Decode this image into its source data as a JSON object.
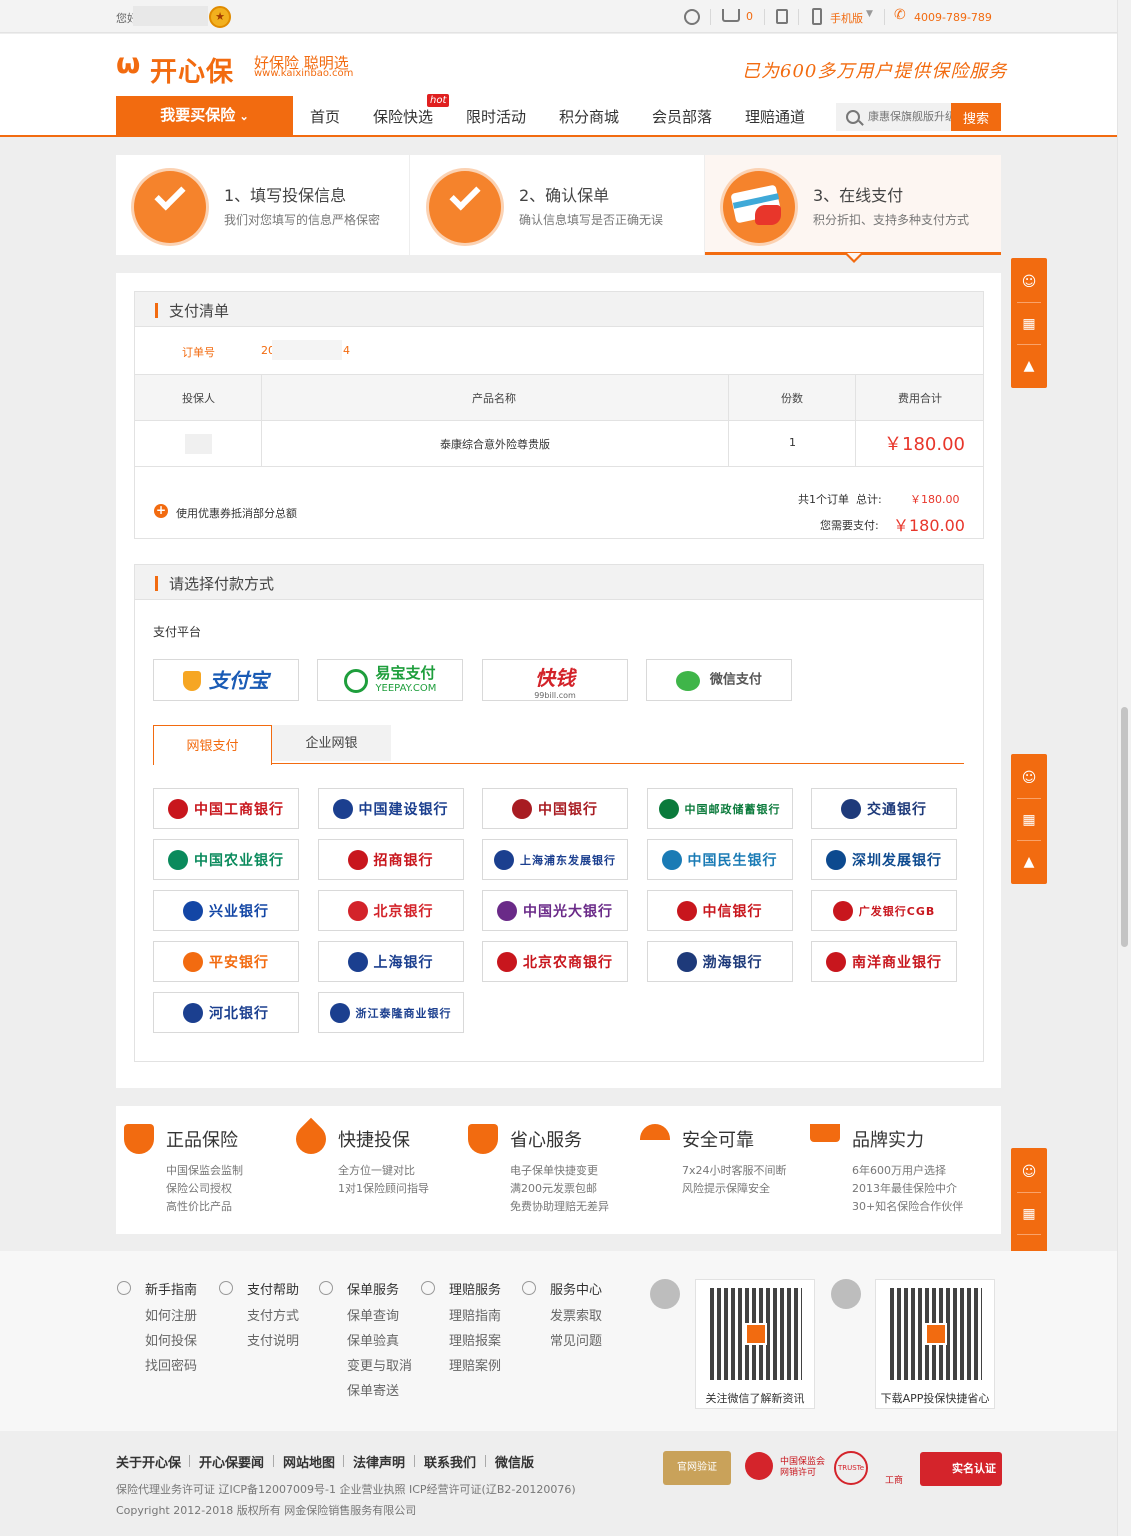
{
  "topbar": {
    "greeting": "您好",
    "cart_count": "0",
    "mobile_label": "手机版",
    "phone": "4009-789-789"
  },
  "header": {
    "logo_name": "开心保",
    "logo_slogan": "好保险 聪明选",
    "logo_url": "www.kaixinbao.com",
    "claim": "已为600多万用户提供保险服务",
    "buy_button": "我要买保险",
    "nav": [
      "首页",
      "保险快选",
      "限时活动",
      "积分商城",
      "会员部落",
      "理赔通道"
    ],
    "hot_badge": "hot",
    "search_placeholder": "康惠保旗舰版升级",
    "search_button": "搜索"
  },
  "steps": [
    {
      "title": "1、填写投保信息",
      "sub": "我们对您填写的信息严格保密"
    },
    {
      "title": "2、确认保单",
      "sub": "确认信息填写是否正确无误"
    },
    {
      "title": "3、在线支付",
      "sub": "积分折扣、支持多种支付方式"
    }
  ],
  "payment_list": {
    "title": "支付清单",
    "order_label": "订单号",
    "order_no_start": "20",
    "order_no_end": "4",
    "columns": [
      "投保人",
      "产品名称",
      "份数",
      "费用合计"
    ],
    "rows": [
      {
        "insured": "",
        "product": "泰康综合意外险尊贵版",
        "qty": "1",
        "total": "￥180.00"
      }
    ],
    "coupon_label": "使用优惠券抵消部分总额",
    "summary_label": "共1个订单  总计:",
    "summary_value": "￥180.00",
    "pay_label": "您需要支付:",
    "pay_value": "￥180.00"
  },
  "payment_method": {
    "title": "请选择付款方式",
    "platform_label": "支付平台",
    "platforms": [
      {
        "name": "支付宝",
        "color": "#1a5bb5"
      },
      {
        "name": "易宝支付",
        "sub": "YEEPAY.COM",
        "color": "#1e9e3c"
      },
      {
        "name": "快钱",
        "sub": "99bill.com",
        "color": "#d3232a"
      },
      {
        "name": "微信支付",
        "color": "#555555"
      }
    ],
    "tabs": [
      "网银支付",
      "企业网银"
    ],
    "banks": [
      {
        "name": "中国工商银行",
        "color": "#c8161d"
      },
      {
        "name": "中国建设银行",
        "color": "#1b3f8f"
      },
      {
        "name": "中国银行",
        "color": "#a81c22"
      },
      {
        "name": "中国邮政储蓄银行",
        "color": "#0a7a3b"
      },
      {
        "name": "交通银行",
        "color": "#1e3a7a"
      },
      {
        "name": "中国农业银行",
        "color": "#0a8a5c"
      },
      {
        "name": "招商银行",
        "color": "#c8161d"
      },
      {
        "name": "上海浦东发展银行",
        "color": "#1b3f8f"
      },
      {
        "name": "中国民生银行",
        "color": "#1a7bb5"
      },
      {
        "name": "深圳发展银行",
        "color": "#0d4a8f"
      },
      {
        "name": "兴业银行",
        "color": "#1346a5"
      },
      {
        "name": "北京银行",
        "color": "#d3232a"
      },
      {
        "name": "中国光大银行",
        "color": "#6a2a88"
      },
      {
        "name": "中信银行",
        "color": "#c8161d"
      },
      {
        "name": "广发银行CGB",
        "color": "#c8161d"
      },
      {
        "name": "平安银行",
        "color": "#f26b10"
      },
      {
        "name": "上海银行",
        "color": "#1b3f8f"
      },
      {
        "name": "北京农商银行",
        "color": "#c8161d"
      },
      {
        "name": "渤海银行",
        "color": "#1e3a7a"
      },
      {
        "name": "南洋商业银行",
        "color": "#c8161d"
      },
      {
        "name": "河北银行",
        "color": "#1b3f8f"
      },
      {
        "name": "浙江泰隆商业银行",
        "color": "#1b3f8f"
      }
    ]
  },
  "features": [
    {
      "title": "正品保险",
      "lines": [
        "中国保监会监制",
        "保险公司授权",
        "高性价比产品"
      ],
      "icon": "shield-icon"
    },
    {
      "title": "快捷投保",
      "lines": [
        "全方位一键对比",
        "1对1保险顾问指导"
      ],
      "icon": "rocket-icon"
    },
    {
      "title": "省心服务",
      "lines": [
        "电子保单快捷变更",
        "满200元发票包邮",
        "免费协助理赔无差异"
      ],
      "icon": "badge-icon"
    },
    {
      "title": "安全可靠",
      "lines": [
        "7x24小时客服不间断",
        "风险提示保障安全"
      ],
      "icon": "umbrella-icon"
    },
    {
      "title": "品牌实力",
      "lines": [
        "6年600万用户选择",
        "2013年最佳保险中介",
        "30+知名保险合作伙伴"
      ],
      "icon": "crown-icon"
    }
  ],
  "footer": {
    "columns": [
      {
        "title": "新手指南",
        "links": [
          "如何注册",
          "如何投保",
          "找回密码"
        ]
      },
      {
        "title": "支付帮助",
        "links": [
          "支付方式",
          "支付说明"
        ]
      },
      {
        "title": "保单服务",
        "links": [
          "保单查询",
          "保单验真",
          "变更与取消",
          "保单寄送"
        ]
      },
      {
        "title": "理赔服务",
        "links": [
          "理赔指南",
          "理赔报案",
          "理赔案例"
        ]
      },
      {
        "title": "服务中心",
        "links": [
          "发票索取",
          "常见问题"
        ]
      }
    ],
    "qr_wechat_caption": "关注微信了解新资讯",
    "qr_app_caption": "下载APP投保快捷省心",
    "bottom_links": [
      "关于开心保",
      "开心保要闻",
      "网站地图",
      "法律声明",
      "联系我们",
      "微信版"
    ],
    "license": "保险代理业务许可证  辽ICP备12007009号-1  企业营业执照  ICP经营许可证(辽B2-20120076)",
    "copyright": "Copyright 2012-2018 版权所有 网金保险销售服务有限公司",
    "certs": [
      "官网验证",
      "中国保监会网销许可",
      "TRUSTe",
      "工商",
      "实名认证"
    ]
  },
  "colors": {
    "brand": "#f26b10",
    "price": "#e8362b"
  }
}
